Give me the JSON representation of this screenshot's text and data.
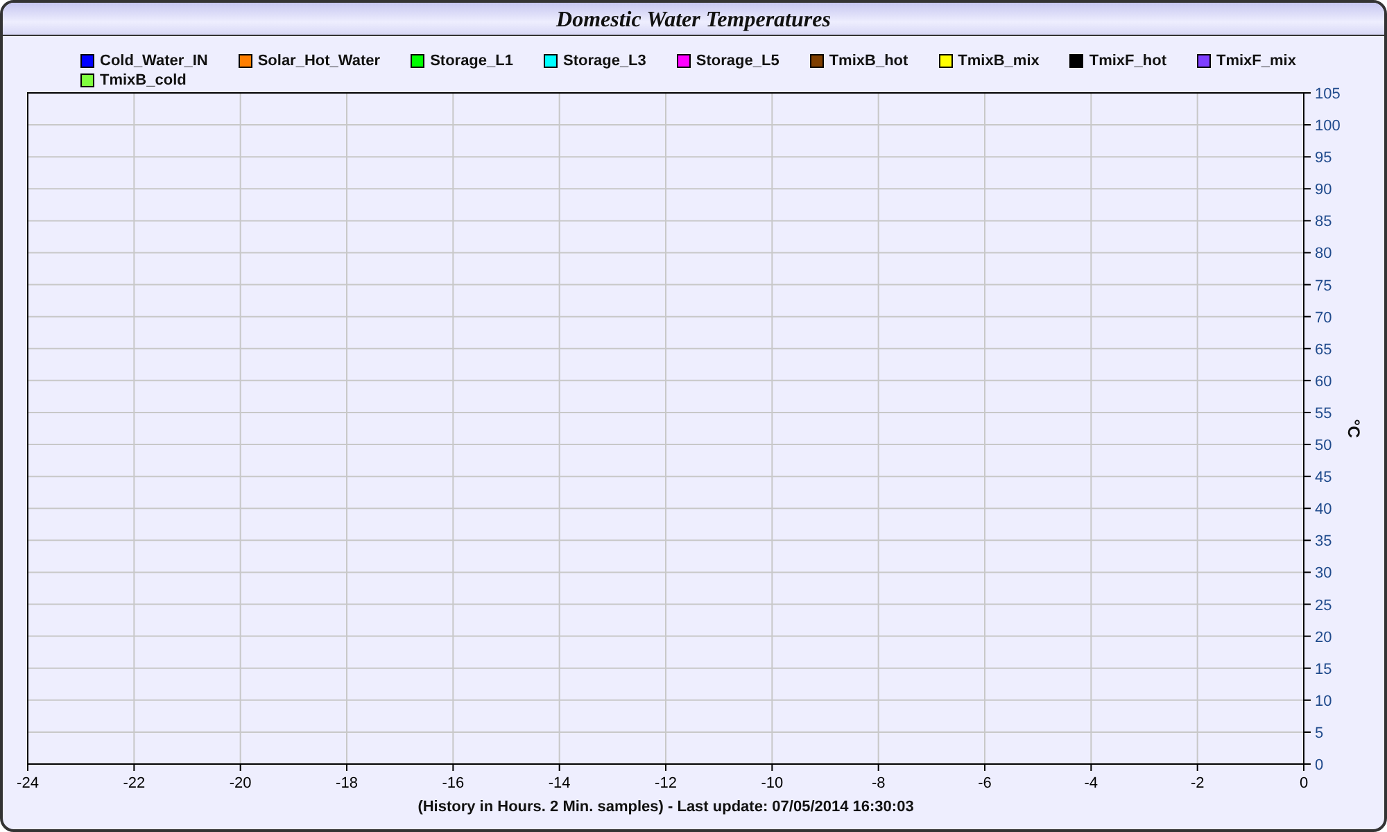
{
  "panel": {
    "chart_data": {
      "type": "line",
      "title": "Domestic Water Temperatures",
      "xlabel": "(History in Hours. 2 Min. samples) - Last update: 07/05/2014 16:30:03",
      "ylabel": "°C",
      "grid": true,
      "ylim": [
        0,
        105
      ],
      "categories": [
        "-24",
        "-22",
        "-20",
        "-18",
        "-16",
        "-14",
        "-12",
        "-10",
        "-8",
        "-6",
        "-4",
        "-2",
        "0"
      ],
      "yticks": [
        0,
        5,
        10,
        15,
        20,
        25,
        30,
        35,
        40,
        45,
        50,
        55,
        60,
        65,
        70,
        75,
        80,
        85,
        90,
        95,
        100,
        105
      ],
      "series": [
        {
          "name": "Cold_Water_IN",
          "color": "#0000ff",
          "values": [
            null,
            null,
            null,
            null,
            null,
            null,
            null,
            null,
            null,
            null,
            null,
            null,
            null
          ]
        },
        {
          "name": "Solar_Hot_Water",
          "color": "#ff7f00",
          "values": [
            null,
            null,
            null,
            null,
            null,
            null,
            null,
            null,
            null,
            null,
            null,
            null,
            null
          ]
        },
        {
          "name": "Storage_L1",
          "color": "#00ff00",
          "values": [
            null,
            null,
            null,
            null,
            null,
            null,
            null,
            null,
            null,
            null,
            null,
            null,
            null
          ]
        },
        {
          "name": "Storage_L3",
          "color": "#00ffff",
          "values": [
            null,
            null,
            null,
            null,
            null,
            null,
            null,
            null,
            null,
            null,
            null,
            null,
            null
          ]
        },
        {
          "name": "Storage_L5",
          "color": "#ff00ff",
          "values": [
            null,
            null,
            null,
            null,
            null,
            null,
            null,
            null,
            null,
            null,
            null,
            null,
            null
          ]
        },
        {
          "name": "TmixB_hot",
          "color": "#7f3f00",
          "values": [
            null,
            null,
            null,
            null,
            null,
            null,
            null,
            null,
            null,
            null,
            null,
            null,
            null
          ]
        },
        {
          "name": "TmixB_mix",
          "color": "#ffff00",
          "values": [
            null,
            null,
            null,
            null,
            null,
            null,
            null,
            null,
            null,
            null,
            null,
            null,
            null
          ]
        },
        {
          "name": "TmixF_hot",
          "color": "#000000",
          "values": [
            null,
            null,
            null,
            null,
            null,
            null,
            null,
            null,
            null,
            null,
            null,
            null,
            null
          ]
        },
        {
          "name": "TmixF_mix",
          "color": "#7f3fff",
          "values": [
            null,
            null,
            null,
            null,
            null,
            null,
            null,
            null,
            null,
            null,
            null,
            null,
            null
          ]
        },
        {
          "name": "TmixB_cold",
          "color": "#7fff3f",
          "values": [
            null,
            null,
            null,
            null,
            null,
            null,
            null,
            null,
            null,
            null,
            null,
            null,
            null
          ]
        }
      ]
    }
  }
}
